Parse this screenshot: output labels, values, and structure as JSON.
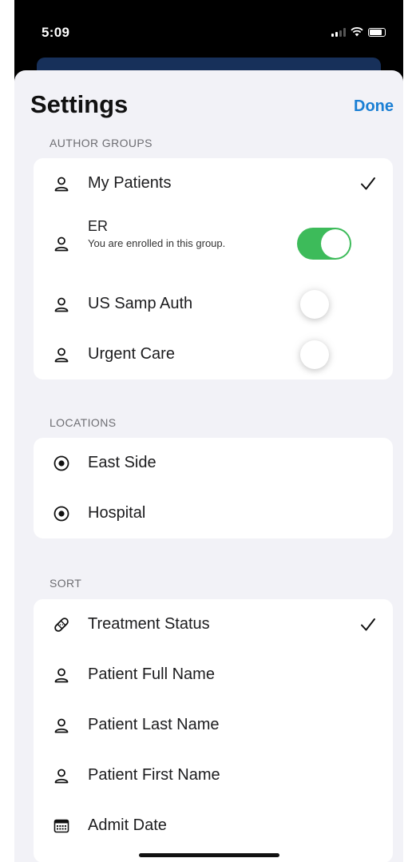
{
  "status_bar": {
    "time": "5:09"
  },
  "header": {
    "title": "Settings",
    "done_label": "Done"
  },
  "author_groups": {
    "label": "AUTHOR GROUPS",
    "items": [
      {
        "label": "My Patients",
        "icon": "person-icon",
        "checked": true
      },
      {
        "label": "ER",
        "subtitle": "You are enrolled in this group.",
        "icon": "person-icon",
        "toggle": "on"
      },
      {
        "label": "US Samp Auth",
        "icon": "person-icon",
        "toggle": "off"
      },
      {
        "label": "Urgent Care",
        "icon": "person-icon",
        "toggle": "off"
      }
    ]
  },
  "locations": {
    "label": "LOCATIONS",
    "items": [
      {
        "label": "East Side",
        "icon": "radio-dot-icon"
      },
      {
        "label": "Hospital",
        "icon": "radio-dot-icon"
      }
    ]
  },
  "sort": {
    "label": "SORT",
    "items": [
      {
        "label": "Treatment Status",
        "icon": "bandage-icon",
        "checked": true
      },
      {
        "label": "Patient Full Name",
        "icon": "person-icon"
      },
      {
        "label": "Patient Last Name",
        "icon": "person-icon"
      },
      {
        "label": "Patient First Name",
        "icon": "person-icon"
      },
      {
        "label": "Admit Date",
        "icon": "calendar-icon"
      }
    ]
  },
  "colors": {
    "accent": "#1a7fd4",
    "toggle_on": "#3dbb5a",
    "background": "#f2f2f7"
  }
}
